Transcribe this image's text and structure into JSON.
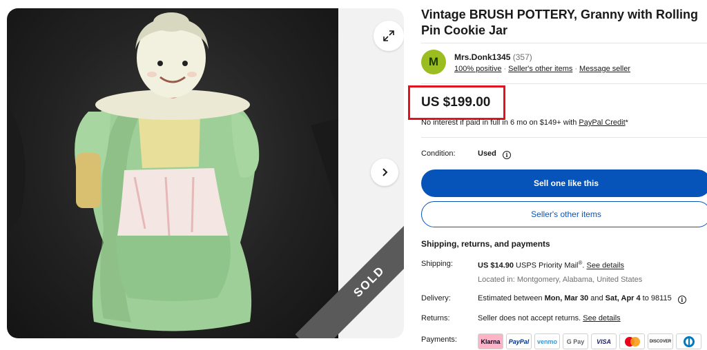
{
  "listing": {
    "title": "Vintage BRUSH POTTERY, Granny with Rolling Pin Cookie Jar",
    "sold_label": "SOLD"
  },
  "seller": {
    "avatar_letter": "M",
    "name": "Mrs.Donk1345",
    "score": "(357)",
    "positive": "100% positive",
    "other_items": "Seller's other items",
    "message": "Message seller",
    "avatar_color": "#9bbd1f"
  },
  "price": {
    "amount": "US $199.00",
    "financing_text": "No interest if paid in full in 6 mo on $149+ with ",
    "financing_link": "PayPal Credit",
    "financing_suffix": "*",
    "highlight_color": "#e0141e"
  },
  "condition": {
    "label": "Condition:",
    "value": "Used"
  },
  "buttons": {
    "sell_one": "Sell one like this",
    "other_items": "Seller's other items",
    "primary_color": "#0654ba"
  },
  "shipping": {
    "section_title": "Shipping, returns, and payments",
    "shipping_label": "Shipping:",
    "shipping_price": "US $14.90",
    "shipping_service": " USPS Priority Mail",
    "shipping_reg": "®",
    "shipping_dot": ". ",
    "shipping_link": "See details",
    "location": "Located in: Montgomery, Alabama, United States",
    "delivery_label": "Delivery:",
    "delivery_prefix": "Estimated between ",
    "delivery_start": "Mon, Mar 30",
    "delivery_and": " and ",
    "delivery_end": "Sat, Apr 4",
    "delivery_suffix": " to 98115",
    "returns_label": "Returns:",
    "returns_text": "Seller does not accept returns. ",
    "returns_link": "See details",
    "payments_label": "Payments:"
  },
  "payment_methods": [
    {
      "name": "Klarna",
      "bg": "#ffb3c7",
      "fg": "#0b051d"
    },
    {
      "name": "PayPal",
      "bg": "#ffffff",
      "fg": "#003087"
    },
    {
      "name": "venmo",
      "bg": "#ffffff",
      "fg": "#3d95ce"
    },
    {
      "name": "G Pay",
      "bg": "#ffffff",
      "fg": "#5f6368"
    },
    {
      "name": "VISA",
      "bg": "#ffffff",
      "fg": "#1a1f71"
    },
    {
      "name": "mastercard-icon",
      "bg": "#ffffff",
      "fg": "#eb001b"
    },
    {
      "name": "DISCOVER",
      "bg": "#ffffff",
      "fg": "#231f20"
    },
    {
      "name": "diners-club-icon",
      "bg": "#ffffff",
      "fg": "#0079be"
    }
  ]
}
